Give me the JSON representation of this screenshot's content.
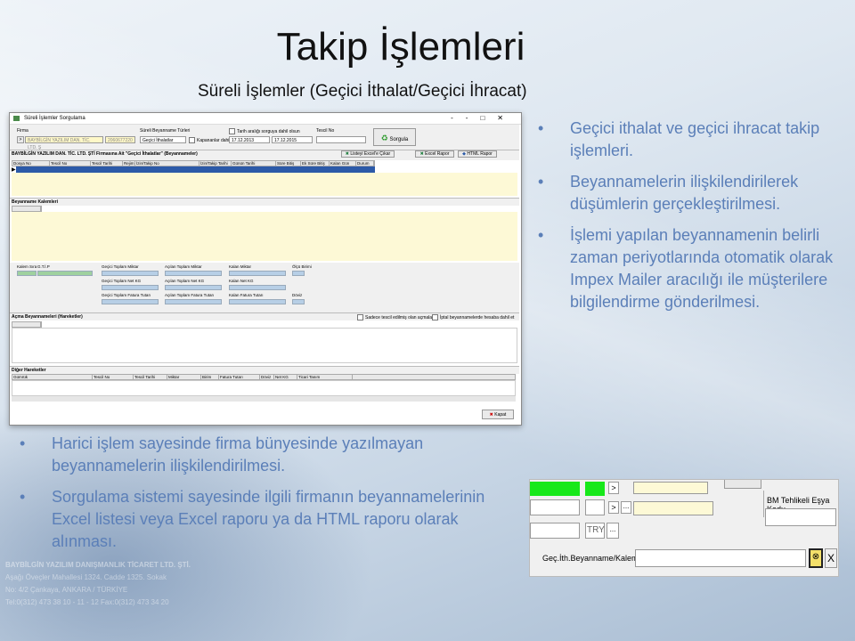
{
  "slide": {
    "title": "Takip İşlemleri",
    "subtitle": "Süreli İşlemler (Geçici İthalat/Geçici İhracat)",
    "right_bullets": [
      "Geçici ithalat ve geçici ihracat takip işlemleri.",
      "Beyannamelerin ilişkilendirilerek düşümlerin gerçekleştirilmesi.",
      "İşlemi yapılan beyannamenin belirli zaman periyotlarında otomatik olarak Impex Mailer aracılığı ile müşterilere bilgilendirme gönderilmesi."
    ],
    "bottom_bullets": [
      "Harici işlem sayesinde firma bünyesinde yazılmayan beyannamelerin ilişkilendirilmesi.",
      "Sorgulama sistemi sayesinde ilgili firmanın beyannamelerinin Excel listesi veya Excel raporu ya da HTML raporu olarak alınması."
    ],
    "footer_lines": [
      "BAYBİLGİN YAZILIM DANIŞMANLIK TİCARET LTD. ŞTİ.",
      "Aşağı Öveçler Mahallesi 1324. Cadde 1325. Sokak",
      "No: 4/2 Çankaya, ANKARA / TÜRKİYE",
      "Tel:0(312) 473 38 10 - 11 - 12 Fax:0(312) 473 34 20"
    ]
  },
  "window": {
    "title": "Süreli İşlemler Sorgulama",
    "controls": [
      "--",
      "□",
      "✕"
    ],
    "filter": {
      "firma_label": "Firma",
      "firma_value": "BAYBİLGİN YAZILIM DAN. TİC. LTD. Ş",
      "firma_code": "2060677220",
      "type_label": "Süreli Beyanname Türleri",
      "type_value": "Geçici İthalatlar",
      "closed_label": "Kapananlar dahil",
      "date_label": "Tarih aralığı sorguya dahil olsun",
      "date_from": "17.12.2013",
      "date_to": "17.12.2015",
      "tescil_label": "Tescil No",
      "query_button": "Sorgula"
    },
    "section1": {
      "title": "BAYBİLGİN YAZILIM DAN. TİC. LTD. ŞTİ Firmasına Ait \"Geçici İthalatlar\" (Beyannameler)",
      "buttons": [
        "Listeyi Excel'e Çıkar",
        "Excel Rapor",
        "HTML Rapor"
      ],
      "columns": [
        "Dosya No",
        "Tescil No",
        "Tescil Tarihi",
        "Rejim",
        "İzin/Takip No",
        "İzin/Takip Tarihi",
        "Günün Tarihi",
        "Süre Bitiş",
        "Ek Süre Bitiş",
        "Kalan Gün",
        "Durum"
      ]
    },
    "section2": {
      "title": "Beyanname Kalemleri"
    },
    "detail": {
      "labels": [
        "Kalem Sıra",
        "G.T.İ.P",
        "Geçici Toplam Miktar",
        "Açılan Toplam Miktar",
        "Kalan Miktar",
        "Ölçü Birimi",
        "Geçici Toplam Net KG",
        "Açılan Toplam Net KG",
        "Kalan Net KG",
        "Geçici Toplam Fatura Tutarı",
        "Açılan Toplam Fatura Tutarı",
        "Kalan Fatura Tutarı",
        "Döviz"
      ]
    },
    "section3": {
      "title": "Açma Beyannameleri (Hareketler)",
      "check1": "Sadece tescil edilmiş olan açmalar",
      "check2": "İptal beyannamelerde hesaba dahil et"
    },
    "section4": {
      "title": "Diğer Hareketler",
      "columns": [
        "Gümrük",
        "Tescil No",
        "Tescil Tarihi",
        "Miktar",
        "Birim",
        "Fatura Tutarı",
        "Döviz",
        "Net KG",
        "Ticari Tanım"
      ]
    },
    "close_button": "Kapat"
  },
  "inset": {
    "label1": "BM Tehlikeli Eşya Kodu",
    "currency": "TRY",
    "label2": "Geç.İth.Beyanname/Kalem No",
    "gt_symbol": ">",
    "ellipsis": "...",
    "close_x": "X"
  },
  "colors": {
    "bullet": "#5b7fb8",
    "grid_selection": "#2c5aa8",
    "highlight_green": "#17e81a"
  }
}
